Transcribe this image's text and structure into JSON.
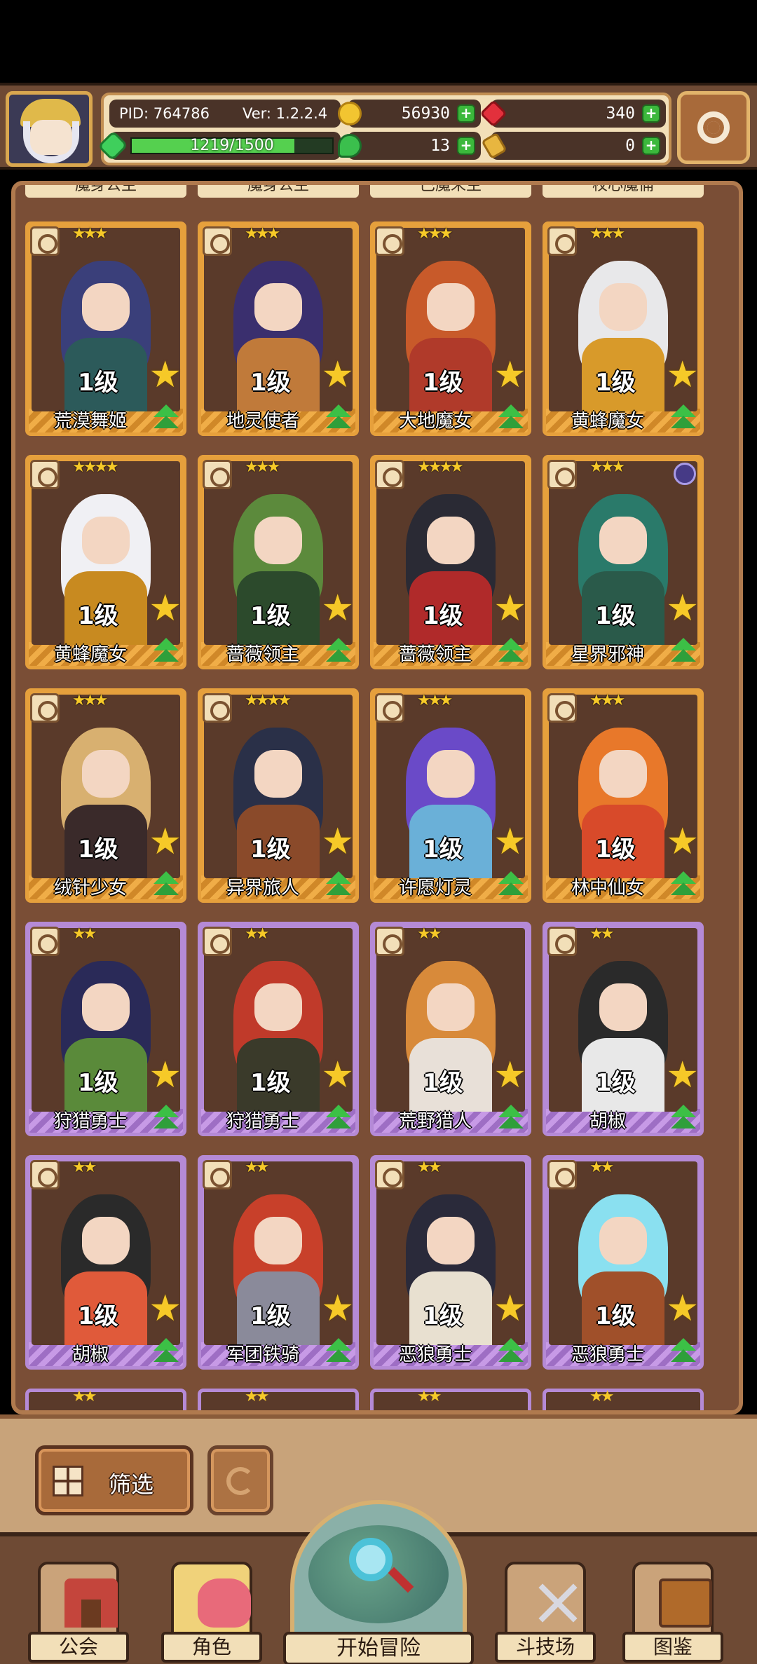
{
  "header": {
    "pid": "PID: 764786",
    "version": "Ver: 1.2.2.4",
    "gold": "56930",
    "gems": "340",
    "exp_text": "1219/1500",
    "exp_fraction": 0.81,
    "clover": "13",
    "tickets": "0"
  },
  "top_row_partial_names": [
    "魔身公主",
    "魔身公主",
    "巴魔来主",
    "校心魔俑"
  ],
  "cards": [
    {
      "name": "荒漠舞姬",
      "level": "1级",
      "stars": "★★★",
      "rarity": "gold",
      "hair": "#3a3f7a",
      "body": "#2c5a5a"
    },
    {
      "name": "地灵使者",
      "level": "1级",
      "stars": "★★★",
      "rarity": "gold",
      "hair": "#3a2f6e",
      "body": "#c07a3a"
    },
    {
      "name": "大地魔女",
      "level": "1级",
      "stars": "★★★",
      "rarity": "gold",
      "hair": "#c85a2a",
      "body": "#b03a2a"
    },
    {
      "name": "黄蜂魔女",
      "level": "1级",
      "stars": "★★★",
      "rarity": "gold",
      "hair": "#e8e8ea",
      "body": "#d89a2a"
    },
    {
      "name": "黄蜂魔女",
      "level": "1级",
      "stars": "★★★★",
      "rarity": "gold",
      "hair": "#f0f0f4",
      "body": "#c88a20"
    },
    {
      "name": "蔷薇领主",
      "level": "1级",
      "stars": "★★★",
      "rarity": "gold",
      "hair": "#5c8a3c",
      "body": "#2c4a2c"
    },
    {
      "name": "蔷薇领主",
      "level": "1级",
      "stars": "★★★★",
      "rarity": "gold",
      "hair": "#2a2a34",
      "body": "#b02a2a"
    },
    {
      "name": "星界邪神",
      "level": "1级",
      "stars": "★★★",
      "rarity": "gold",
      "hair": "#2a7a6a",
      "body": "#2a5a4a",
      "sigil": true
    },
    {
      "name": "绒针少女",
      "level": "1级",
      "stars": "★★★",
      "rarity": "gold",
      "hair": "#d8b070",
      "body": "#3a2a2a"
    },
    {
      "name": "异界旅人",
      "level": "1级",
      "stars": "★★★★",
      "rarity": "gold",
      "hair": "#2a3048",
      "body": "#8a4a2a"
    },
    {
      "name": "许愿灯灵",
      "level": "1级",
      "stars": "★★★",
      "rarity": "gold",
      "hair": "#6a4ac8",
      "body": "#6ab0d8"
    },
    {
      "name": "林中仙女",
      "level": "1级",
      "stars": "★★★",
      "rarity": "gold",
      "hair": "#e8782a",
      "body": "#d84a2a"
    },
    {
      "name": "狩猎勇士",
      "level": "1级",
      "stars": "★★",
      "rarity": "purple",
      "hair": "#2a2a58",
      "body": "#5a8a3a"
    },
    {
      "name": "狩猎勇士",
      "level": "1级",
      "stars": "★★",
      "rarity": "purple",
      "hair": "#c03a2a",
      "body": "#3a3a2a"
    },
    {
      "name": "荒野猎人",
      "level": "1级",
      "stars": "★★",
      "rarity": "purple",
      "hair": "#d88a3a",
      "body": "#e8e0d8"
    },
    {
      "name": "胡椒",
      "level": "1级",
      "stars": "★★",
      "rarity": "purple",
      "hair": "#2a2a2a",
      "body": "#e8e8e8"
    },
    {
      "name": "胡椒",
      "level": "1级",
      "stars": "★★",
      "rarity": "purple",
      "hair": "#2a2a2a",
      "body": "#e05a3a"
    },
    {
      "name": "军团铁骑",
      "level": "1级",
      "stars": "★★",
      "rarity": "purple",
      "hair": "#c8402a",
      "body": "#8a8a9a"
    },
    {
      "name": "恶狼勇士",
      "level": "1级",
      "stars": "★★",
      "rarity": "purple",
      "hair": "#2a2a3a",
      "body": "#e8e0d0"
    },
    {
      "name": "恶狼勇士",
      "level": "1级",
      "stars": "★★",
      "rarity": "purple",
      "hair": "#8ae0f0",
      "body": "#a0502a"
    }
  ],
  "bottom_partial_stars": [
    "★★",
    "★★",
    "★★",
    "★★"
  ],
  "filter": {
    "filter_label": "筛选"
  },
  "nav": {
    "guild": "公会",
    "role": "角色",
    "adventure": "开始冒险",
    "arena": "斗技场",
    "codex": "图鉴"
  },
  "colors": {
    "gold_frame": "#e6a03c",
    "purple_frame": "#b58ad6",
    "panel_bg": "#7a4e36",
    "plus_green": "#3cb83c"
  }
}
